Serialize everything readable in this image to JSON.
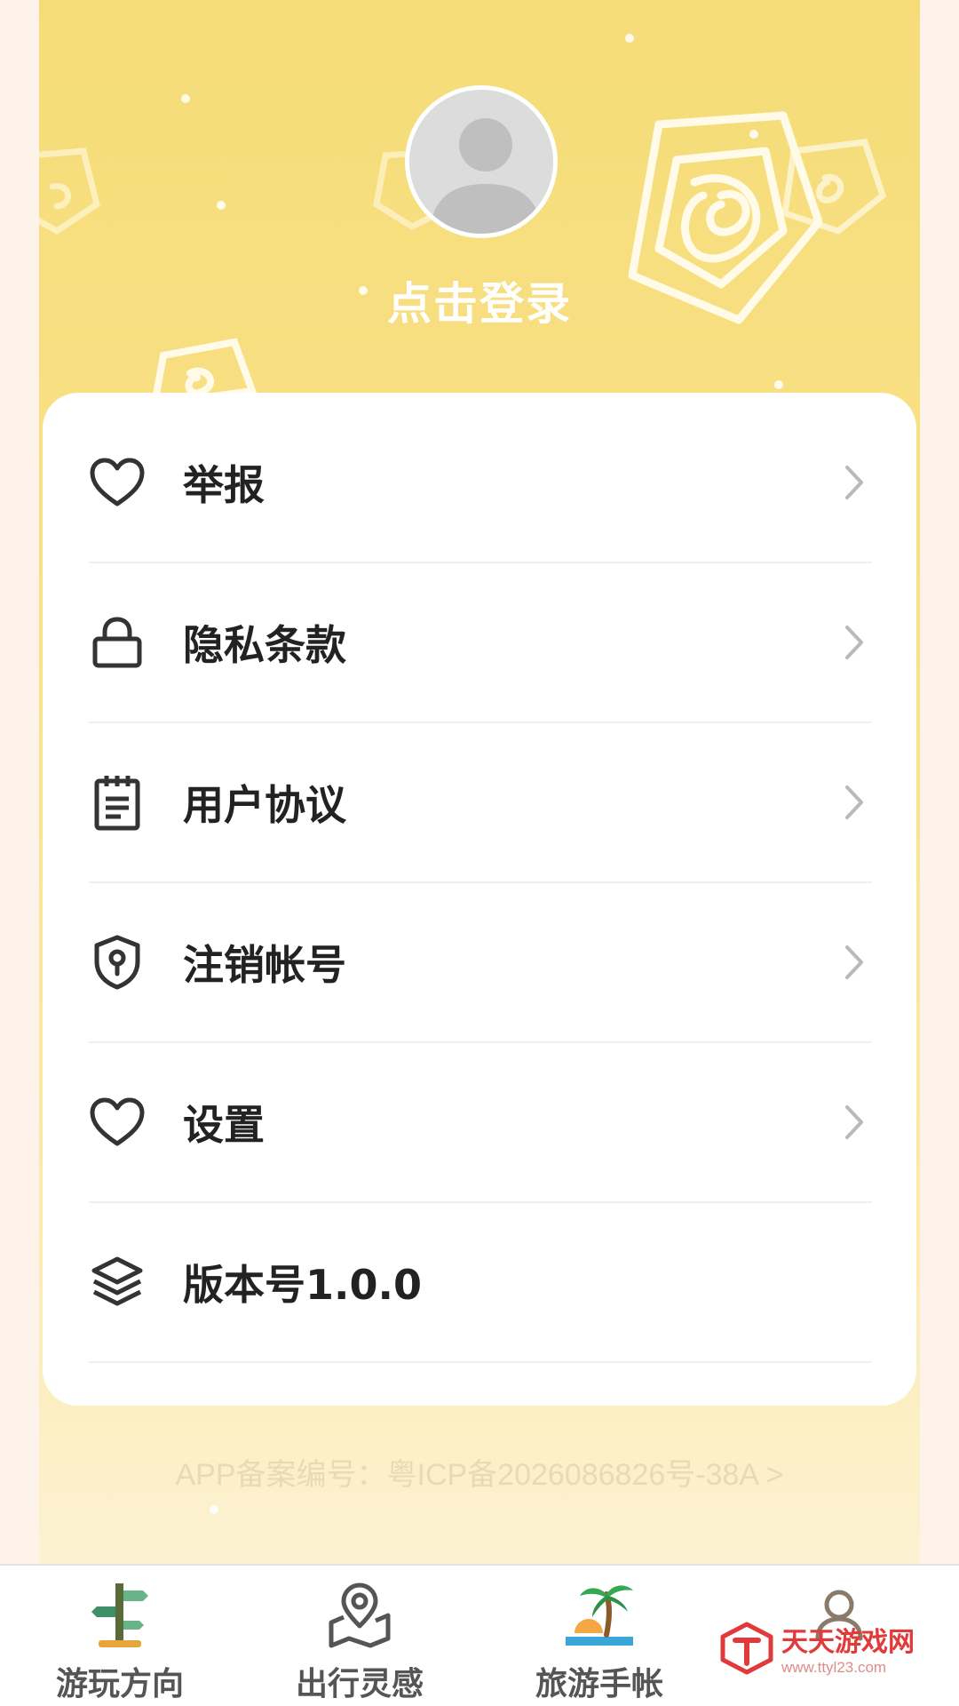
{
  "profile": {
    "login_text": "点击登录"
  },
  "menu": {
    "items": [
      {
        "label": "举报",
        "icon": "heart-icon"
      },
      {
        "label": "隐私条款",
        "icon": "lock-icon"
      },
      {
        "label": "用户协议",
        "icon": "notepad-icon"
      },
      {
        "label": "注销帐号",
        "icon": "shield-keyhole-icon"
      },
      {
        "label": "设置",
        "icon": "heart-icon"
      },
      {
        "label": "版本号1.0.0",
        "icon": "layers-icon"
      }
    ]
  },
  "icp": {
    "text": "APP备案编号：粤ICP备2026086826号-38A >"
  },
  "tabbar": {
    "tabs": [
      {
        "label": "游玩方向",
        "icon": "signpost-icon"
      },
      {
        "label": "出行灵感",
        "icon": "map-pin-icon"
      },
      {
        "label": "旅游手帐",
        "icon": "palm-beach-icon"
      },
      {
        "label": "",
        "icon": "user-icon"
      }
    ]
  },
  "watermark": {
    "name": "天天游戏网",
    "url": "www.ttyl23.com"
  },
  "colors": {
    "header_bg": "#f6dc79",
    "accent_red": "#e2393a",
    "text_dark": "#222222"
  }
}
